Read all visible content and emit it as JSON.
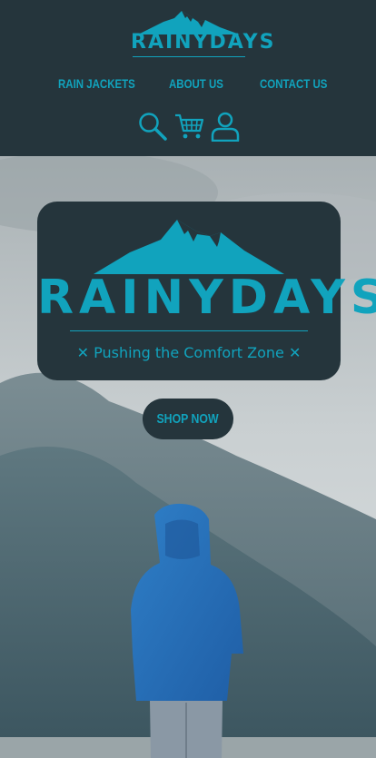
{
  "brand": {
    "name": "RAINYDAYS",
    "tagline": "Pushing the Comfort Zone",
    "accent_color": "#11a3bd",
    "dark_color": "#25353c"
  },
  "nav": {
    "items": [
      {
        "label": "RAIN JACKETS"
      },
      {
        "label": "ABOUT US"
      },
      {
        "label": "CONTACT US"
      }
    ]
  },
  "header_icons": [
    "search-icon",
    "cart-icon",
    "user-icon"
  ],
  "hero": {
    "cta_label": "SHOP NOW",
    "image_description_icon": "person-in-rain-jacket"
  }
}
